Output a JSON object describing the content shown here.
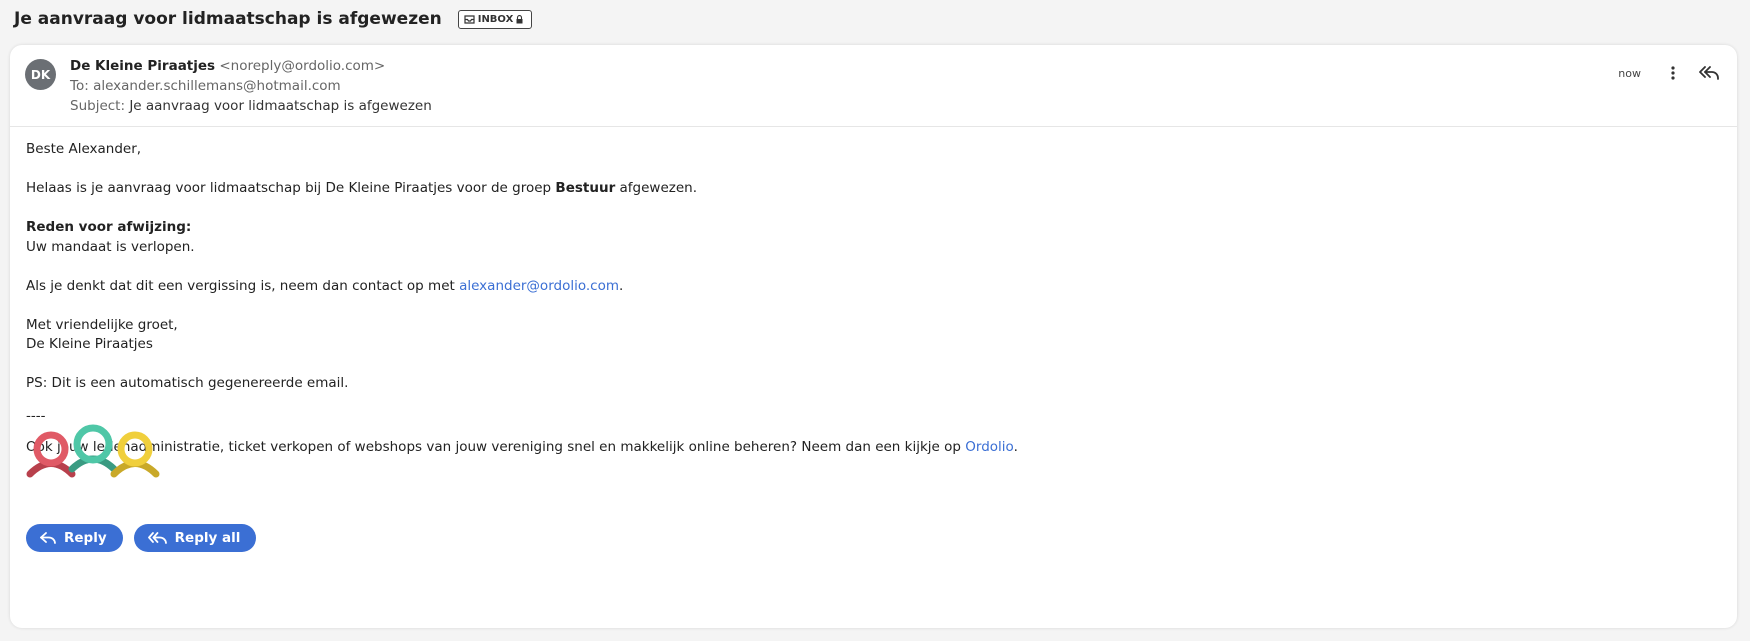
{
  "email": {
    "subject": "Je aanvraag voor lidmaatschap is afgewezen",
    "folder_badge": "INBOX",
    "sender": {
      "initials": "DK",
      "name": "De Kleine Piraatjes",
      "address": "<noreply@ordolio.com>"
    },
    "to_label": "To:",
    "to_value": "alexander.schillemans@hotmail.com",
    "subject_label": "Subject:",
    "time": "now"
  },
  "body": {
    "greeting": "Beste Alexander,",
    "p1_before": "Helaas is je aanvraag voor lidmaatschap bij De Kleine Piraatjes voor de groep ",
    "p1_bold": "Bestuur",
    "p1_after": " afgewezen.",
    "reason_heading": "Reden voor afwijzing:",
    "reason_text": "Uw mandaat is verlopen.",
    "contact_before": "Als je denkt dat dit een vergissing is, neem dan contact op met ",
    "contact_link": "alexander@ordolio.com",
    "contact_after": ".",
    "closing": "Met vriendelijke groet,",
    "signature": "De Kleine Piraatjes",
    "ps": "PS: Dit is een automatisch gegenereerde email.",
    "separator": "----",
    "promo_before": "Ook jouw ledenadministratie, ticket verkopen of webshops van jouw vereniging snel en makkelijk online beheren? Neem dan een kijkje op ",
    "promo_link": "Ordolio",
    "promo_after": "."
  },
  "actions": {
    "reply_label": "Reply",
    "reply_all_label": "Reply all"
  },
  "icons": {
    "badge_icon": "inbox-tray-icon",
    "lock": "lock-icon",
    "more": "kebab-menu-icon",
    "reply_all": "reply-all-icon",
    "reply": "reply-icon"
  },
  "colors": {
    "accent": "#3b6fd4",
    "avatar": "#6b6f74",
    "logo_red": "#e05a66",
    "logo_teal": "#4fc7a7",
    "logo_yellow": "#f0cf3c"
  }
}
